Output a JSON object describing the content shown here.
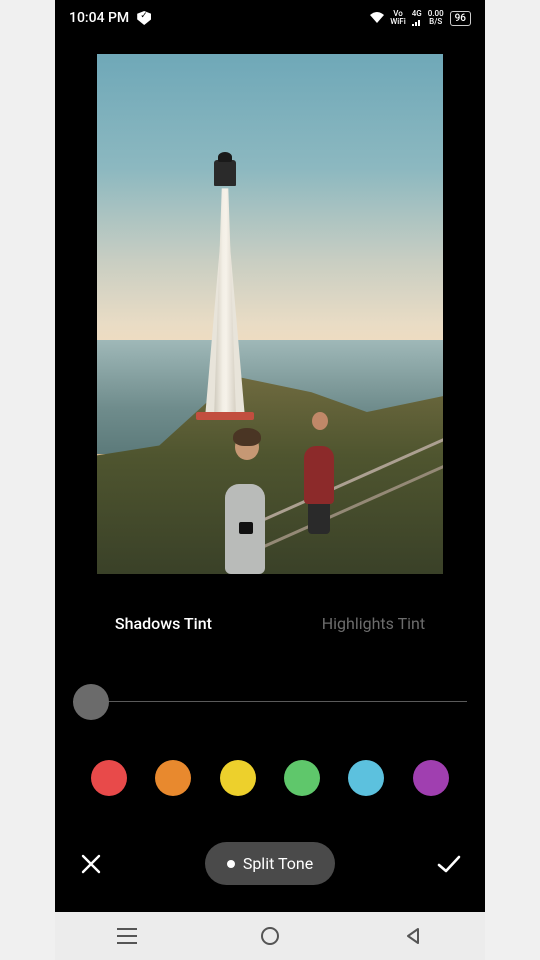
{
  "status": {
    "time": "10:04 PM",
    "wifi_mode_top": "Vo",
    "wifi_mode_bottom": "WiFi",
    "signal": "4G",
    "data_rate_top": "0.00",
    "data_rate_bottom": "B/S",
    "battery": "96"
  },
  "tabs": {
    "shadows": "Shadows Tint",
    "highlights": "Highlights Tint"
  },
  "tool": {
    "label": "Split Tone"
  },
  "swatch_colors": [
    "#e84a4a",
    "#e8892e",
    "#edd02c",
    "#5fc76b",
    "#5cc1de",
    "#a03fb0"
  ],
  "slider": {
    "value": 0
  }
}
